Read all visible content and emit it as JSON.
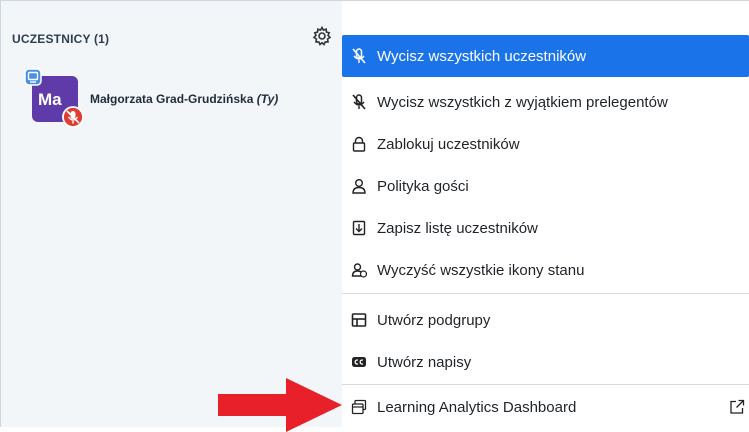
{
  "participants_panel": {
    "title": "UCZESTNICY (1)",
    "user": {
      "initials": "Ma",
      "name": "Małgorzata Grad-Grudzińska",
      "you_label": "(Ty)",
      "avatar_color": "#5e3ba8"
    }
  },
  "menu": {
    "items": [
      {
        "label": "Wycisz wszystkich uczestników",
        "icon": "mute-icon",
        "active": true
      },
      {
        "label": "Wycisz wszystkich z wyjątkiem prelegentów",
        "icon": "mute-icon"
      },
      {
        "label": "Zablokuj uczestników",
        "icon": "lock-icon"
      },
      {
        "label": "Polityka gości",
        "icon": "user-icon"
      },
      {
        "label": "Zapisz listę uczestników",
        "icon": "download-file-icon"
      },
      {
        "label": "Wyczyść wszystkie ikony stanu",
        "icon": "clear-status-icon"
      },
      {
        "label": "Utwórz podgrupy",
        "icon": "rooms-icon"
      },
      {
        "label": "Utwórz napisy",
        "icon": "closed-captions-icon"
      },
      {
        "label": "Learning Analytics Dashboard",
        "icon": "dashboard-icon"
      }
    ]
  },
  "colors": {
    "accent": "#1a73e8",
    "panel_bg": "#f3f6f9",
    "arrow": "#e8202a",
    "muted_badge": "#e03c31"
  }
}
